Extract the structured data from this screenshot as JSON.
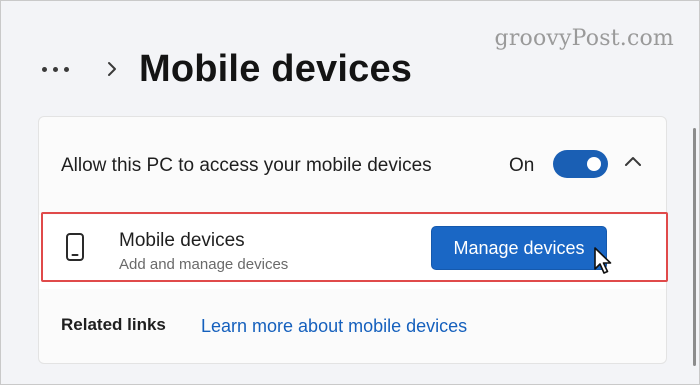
{
  "watermark": "groovyPost.com",
  "breadcrumb": {
    "more_icon": "more-horizontal-icon",
    "separator_icon": "chevron-right-icon",
    "title": "Mobile devices"
  },
  "access_setting": {
    "label": "Allow this PC to access your mobile devices",
    "state_text": "On",
    "toggle_on": true,
    "collapse_icon": "chevron-up-icon"
  },
  "device_row": {
    "icon": "phone-icon",
    "title": "Mobile devices",
    "subtitle": "Add and manage devices",
    "button_label": "Manage devices"
  },
  "related": {
    "label": "Related links",
    "link_text": "Learn more about mobile devices"
  },
  "colors": {
    "accent": "#1a67c5",
    "link": "#1560bd",
    "highlight_border": "#e04a4a"
  }
}
